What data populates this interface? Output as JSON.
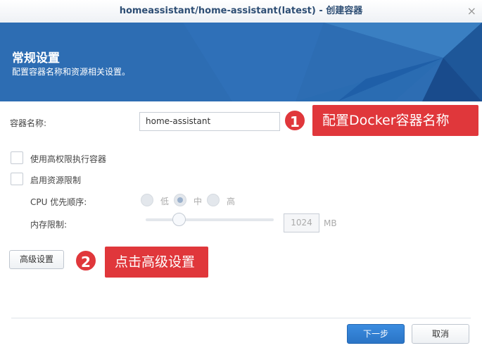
{
  "window": {
    "title": "homeassistant/home-assistant(latest) - 创建容器",
    "close_icon": "×"
  },
  "banner": {
    "title": "常规设置",
    "subtitle": "配置容器名称和资源相关设置。"
  },
  "form": {
    "container_name_label": "容器名称:",
    "container_name_value": "home-assistant",
    "privileged_label": "使用高权限执行容器",
    "privileged_checked": false,
    "resource_limit_label": "启用资源限制",
    "resource_limit_checked": false,
    "cpu_label": "CPU 优先顺序:",
    "cpu_options": [
      "低",
      "中",
      "高"
    ],
    "cpu_selected": "中",
    "memory_label": "内存限制:",
    "memory_value": "1024",
    "memory_unit": "MB",
    "memory_slider_fraction": 0.26,
    "advanced_button": "高级设置"
  },
  "annotations": [
    {
      "number": "1",
      "text": "配置Docker容器名称"
    },
    {
      "number": "2",
      "text": "点击高级设置"
    }
  ],
  "footer": {
    "next_button": "下一步",
    "cancel_button": "取消"
  }
}
